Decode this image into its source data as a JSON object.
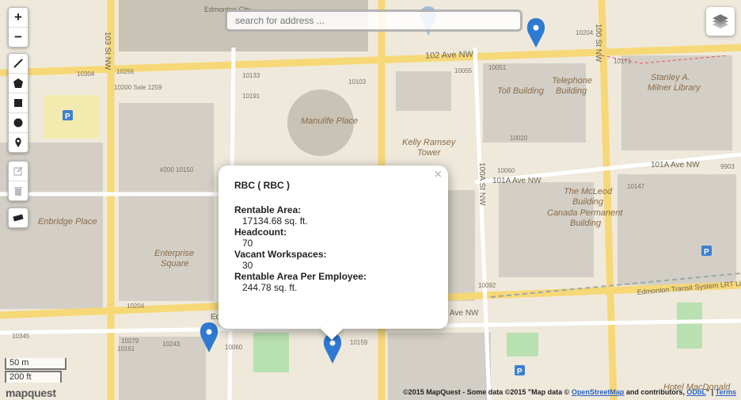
{
  "search": {
    "placeholder": "search for address ..."
  },
  "zoom": {
    "in_label": "+",
    "out_label": "−"
  },
  "draw_tools": [
    "polyline-icon",
    "polygon-icon",
    "rectangle-icon",
    "circle-icon",
    "marker-icon"
  ],
  "edit_tools": [
    "edit-icon",
    "delete-icon"
  ],
  "measure_tool": "ruler-icon",
  "popup": {
    "close": "×",
    "title": "RBC ( RBC )",
    "fields": [
      {
        "label": "Rentable Area:",
        "value": "17134.68 sq. ft."
      },
      {
        "label": "Headcount:",
        "value": "70"
      },
      {
        "label": "Vacant Workspaces:",
        "value": "30"
      },
      {
        "label": "Rentable Area Per Employee:",
        "value": "244.78 sq. ft."
      }
    ]
  },
  "map_labels": {
    "edmonton_city": "Edmonton City",
    "ave102": "102 Ave NW",
    "st103": "103 St NW",
    "st100": "100 St NW",
    "manulife": "Manulife Place",
    "kelly1": "Kelly Ramsey",
    "kelly2": "Tower",
    "toll": "Toll Building",
    "telephone1": "Telephone",
    "telephone2": "Building",
    "stanley1": "Stanley A.",
    "stanley2": "Milner Library",
    "enbridge": "Enbridge Place",
    "enterprise1": "Enterprise",
    "enterprise2": "Square",
    "mcleod1": "The McLeod",
    "mcleod2": "Building",
    "canada1": "Canada Permanent",
    "canada2": "Building",
    "ave101a_left": "101A Ave NW",
    "ave101a_right": "101A Ave NW",
    "st100a": "100A St NW",
    "ave_bottom": "Ave NW",
    "ed_fragment": "Ed",
    "lrt": "Edmonton Transit System LRT Line",
    "hotel": "Hotel MacDonald",
    "num_10304": "10304",
    "num_10256": "10256",
    "num_10200": "10200 Sale 1259",
    "num_10133": "10133",
    "num_10103": "10103",
    "num_10191": "10191",
    "num_10055": "10055",
    "num_10051": "10051",
    "num_10204": "10204",
    "num_10171": "10171",
    "num_10020": "10020",
    "num_10060": "10060",
    "num_10150": "#200 10150",
    "num_10204b": "10204",
    "num_10092": "10092",
    "num_10345": "10345",
    "num_10279": "10279",
    "num_10161": "10161",
    "num_10243": "10243",
    "num_10060b": "10060",
    "num_10159": "10159",
    "num_10147": "10147",
    "num_9903": "9903"
  },
  "scale": {
    "metric": "50 m",
    "imperial": "200 ft"
  },
  "logo": "mapquest",
  "attribution": {
    "prefix": "©2015 MapQuest  -  Some data ©2015 \"Map data © ",
    "osm": "OpenStreetMap",
    "middle": " and contributors, ",
    "odbl": "ODbL",
    "sep": "\" | ",
    "terms": "Terms"
  }
}
